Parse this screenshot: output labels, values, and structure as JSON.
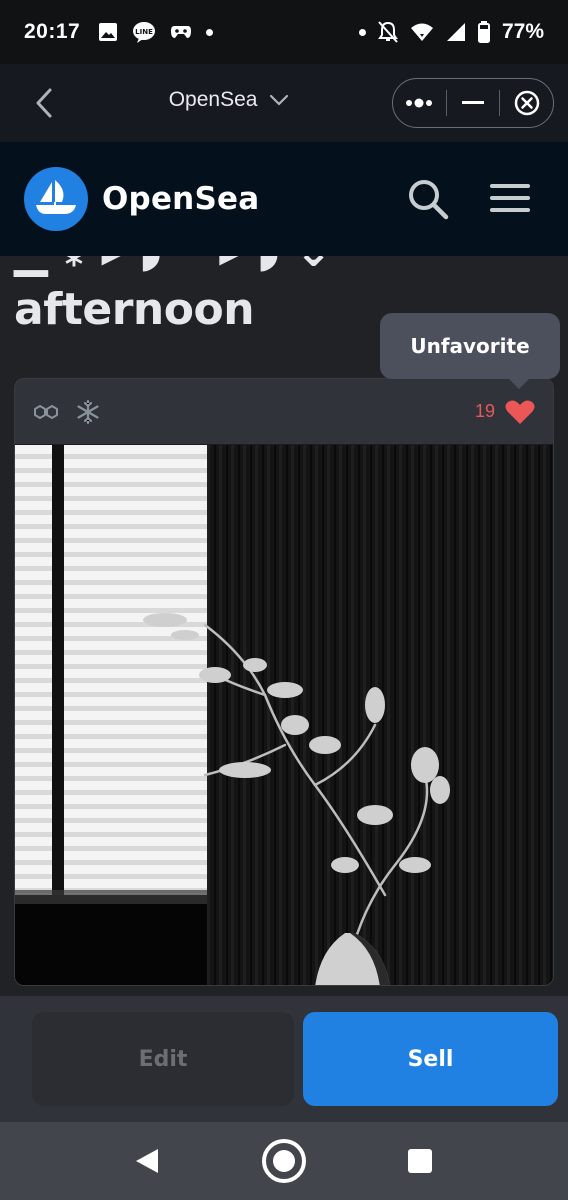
{
  "status_bar": {
    "time": "20:17",
    "battery": "77%",
    "left_icons": [
      "image-icon",
      "line-app-icon",
      "game-controller-icon",
      "notification-dot"
    ],
    "right_icons": [
      "notification-dot",
      "do-not-disturb-icon",
      "wifi-icon",
      "signal-icon",
      "battery-icon"
    ]
  },
  "browser": {
    "title": "OpenSea",
    "capsule_icons": [
      "more-icon",
      "minimize-icon",
      "close-icon"
    ]
  },
  "header": {
    "brand": "OpenSea",
    "brand_color": "#2081e2",
    "icons": [
      "opensea-logo-icon",
      "search-icon",
      "menu-icon"
    ]
  },
  "item": {
    "title_line": "afternoon",
    "favorites_count": "19",
    "chain_icons": [
      "polygon-icon",
      "frozen-metadata-icon"
    ],
    "tooltip": "Unfavorite",
    "favorite_color": "#eb5757"
  },
  "actions": {
    "edit_label": "Edit",
    "sell_label": "Sell",
    "sell_color": "#2081e2"
  },
  "nav": {
    "icons": [
      "nav-back-icon",
      "nav-home-icon",
      "nav-recents-icon"
    ]
  }
}
